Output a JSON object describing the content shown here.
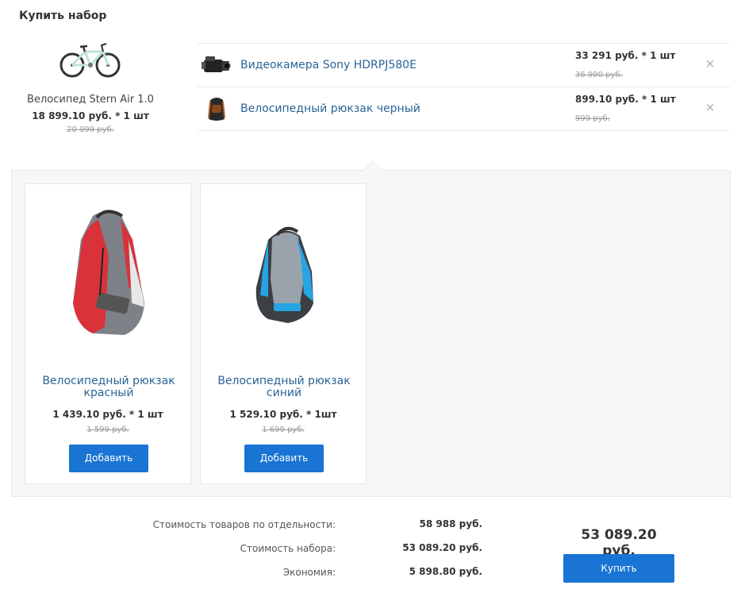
{
  "title": "Купить набор",
  "main_product": {
    "name": "Велосипед Stern Air 1.0",
    "price": "18 899.10 руб. * 1 шт",
    "old_price": "20 999 руб."
  },
  "set_items": [
    {
      "name": "Видеокамера Sony HDRPJ580E",
      "price": "33 291 руб. * 1 шт",
      "old_price": "36 990 руб.",
      "remove": "×"
    },
    {
      "name": "Велосипедный рюкзак черный",
      "price": "899.10 руб. * 1 шт",
      "old_price": "999 руб.",
      "remove": "×"
    }
  ],
  "offers": [
    {
      "name": "Велосипедный рюкзак красный",
      "price": "1 439.10 руб. * 1 шт",
      "old_price": "1 599 руб.",
      "button": "Добавить"
    },
    {
      "name": "Велосипедный рюкзак синий",
      "price": "1 529.10 руб. * 1шт",
      "old_price": "1 699 руб.",
      "button": "Добавить"
    }
  ],
  "totals": {
    "separate_label": "Стоимость товаров по отдельности:",
    "separate_value": "58 988 руб.",
    "set_label": "Стоимость набора:",
    "set_value": "53 089.20 руб.",
    "economy_label": "Экономия:",
    "economy_value": "5 898.80 руб.",
    "grand_total": "53 089.20 руб.",
    "buy_button": "Купить"
  },
  "colors": {
    "accent": "#1a74d3",
    "link": "#2a6496"
  }
}
